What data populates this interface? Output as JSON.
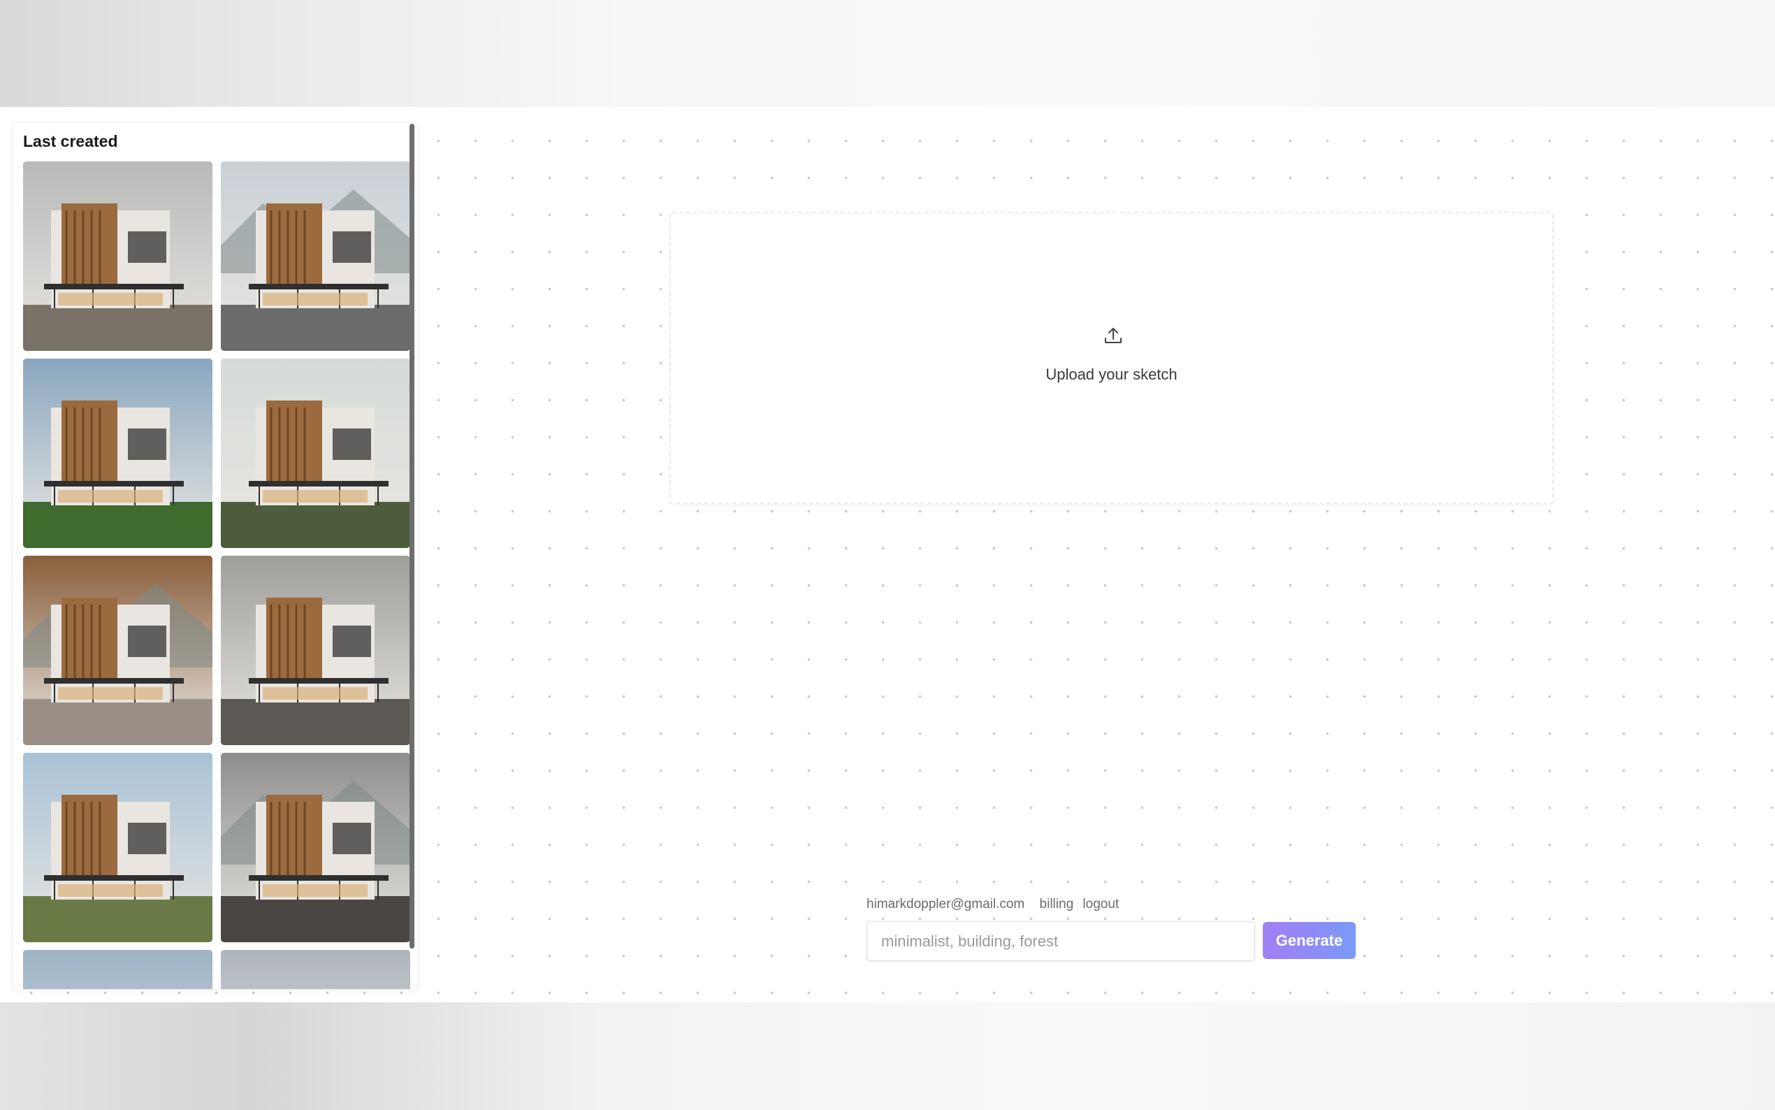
{
  "sidebar": {
    "title": "Last created",
    "thumbnails": [
      {
        "icon": "architecture-render-image",
        "sky": "#b9b9b9",
        "ground": "#7a7268"
      },
      {
        "icon": "architecture-render-image",
        "sky": "#c8d0d6",
        "ground": "#6b6b6b"
      },
      {
        "icon": "architecture-render-image",
        "sky": "#8aa7c0",
        "ground": "#3f6b2e"
      },
      {
        "icon": "architecture-render-image",
        "sky": "#d6dbd8",
        "ground": "#4d5d3c"
      },
      {
        "icon": "architecture-render-image",
        "sky": "#8a5f3c",
        "ground": "#9a8f86"
      },
      {
        "icon": "architecture-render-image",
        "sky": "#9e9e9a",
        "ground": "#5c5954"
      },
      {
        "icon": "architecture-render-image",
        "sky": "#a9c2d6",
        "ground": "#6a7a46"
      },
      {
        "icon": "architecture-render-image",
        "sky": "#8e8e8e",
        "ground": "#4a4643"
      },
      {
        "icon": "architecture-render-image",
        "sky": "#9cb3c6",
        "ground": "#6c7a5a"
      },
      {
        "icon": "architecture-render-image",
        "sky": "#aeb6bd",
        "ground": "#555"
      }
    ]
  },
  "upload": {
    "icon": "upload-icon",
    "label": "Upload your sketch"
  },
  "account": {
    "email": "himarkdoppler@gmail.com",
    "billing_label": "billing",
    "logout_label": "logout"
  },
  "prompt": {
    "placeholder": "minimalist, building, forest",
    "value": ""
  },
  "generate_button": {
    "label": "Generate",
    "colors": [
      "#a27ff5",
      "#7b9bf7"
    ]
  }
}
